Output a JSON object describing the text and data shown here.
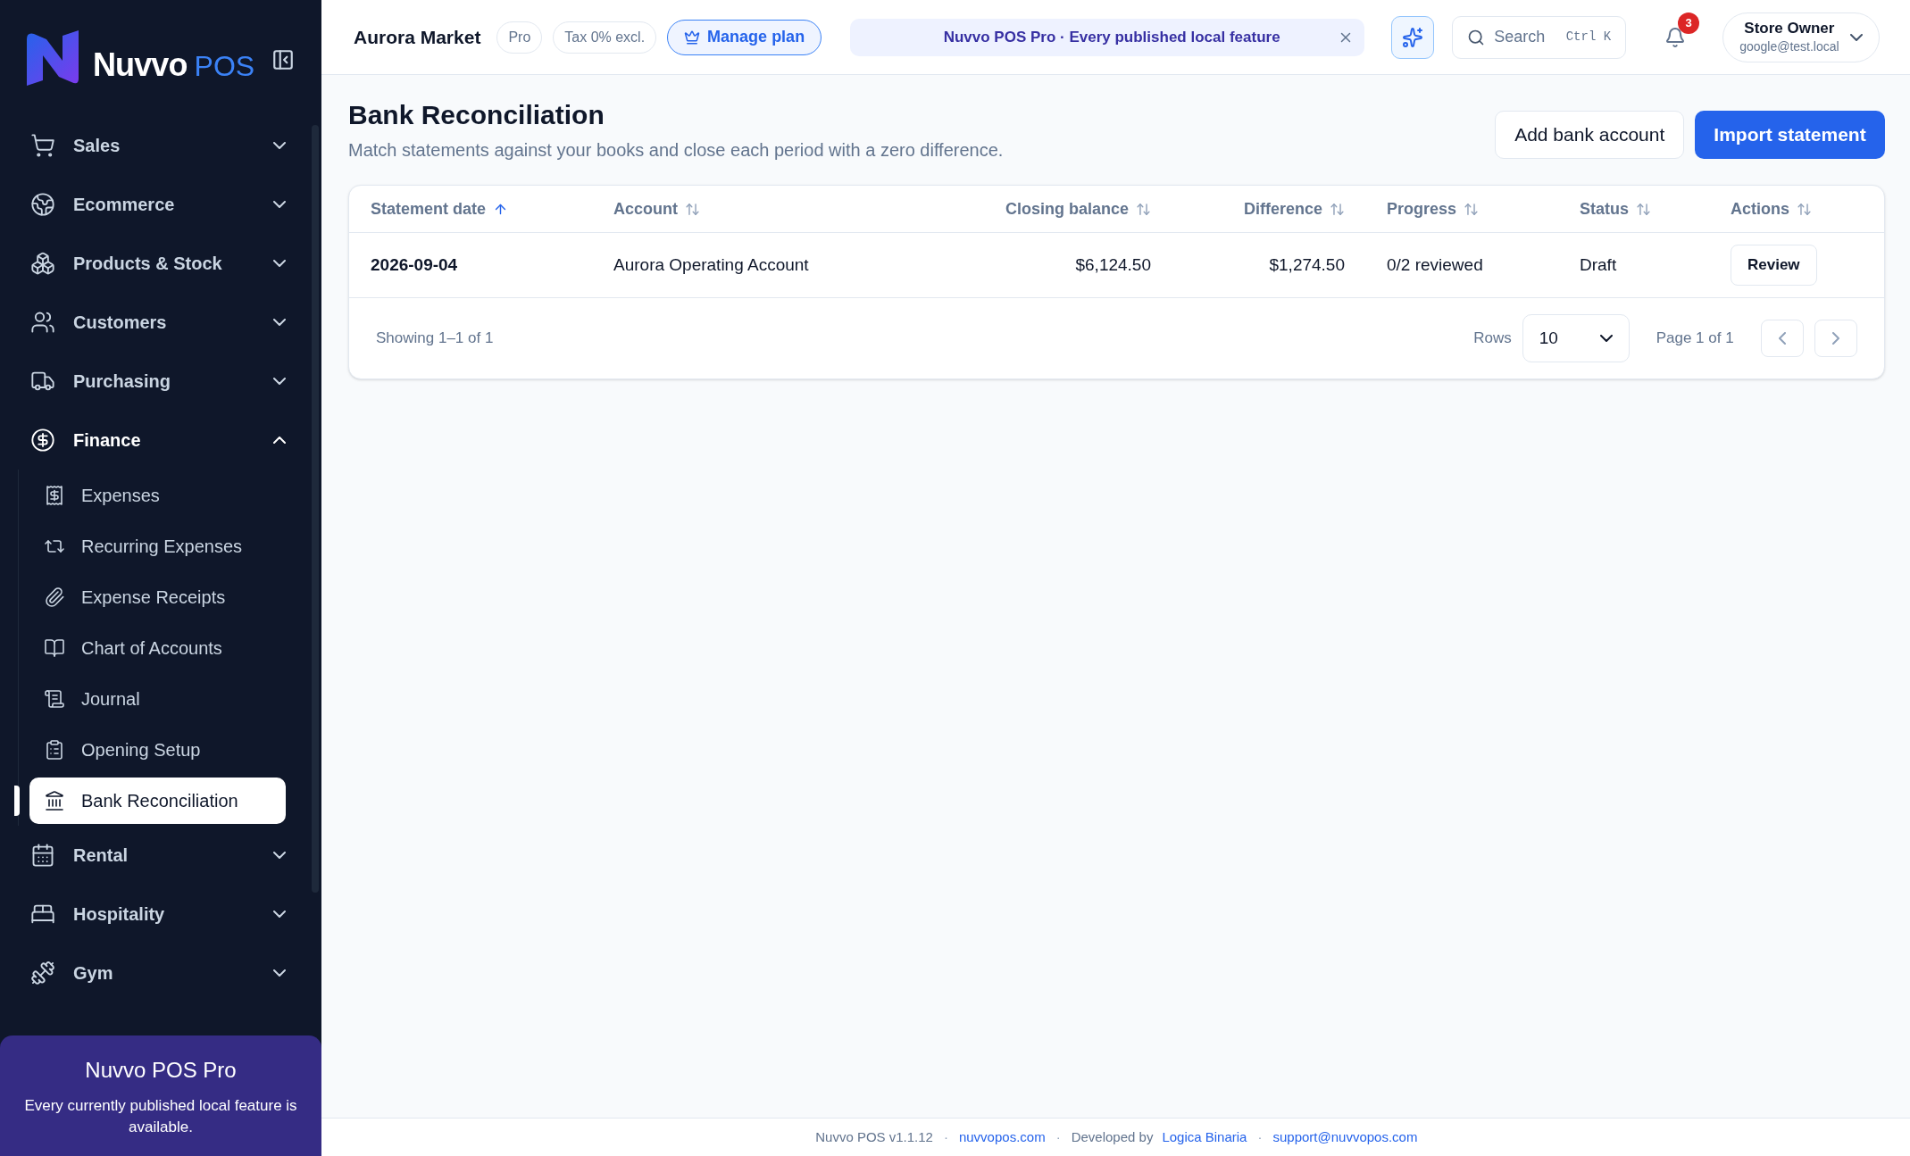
{
  "brand": {
    "name": "Nuvvo",
    "suffix": "POS"
  },
  "sidebar": {
    "items": [
      {
        "label": "Sales",
        "expanded": false
      },
      {
        "label": "Ecommerce",
        "expanded": false
      },
      {
        "label": "Products & Stock",
        "expanded": false
      },
      {
        "label": "Customers",
        "expanded": false
      },
      {
        "label": "Purchasing",
        "expanded": false
      },
      {
        "label": "Finance",
        "expanded": true,
        "children": [
          {
            "label": "Expenses",
            "selected": false
          },
          {
            "label": "Recurring Expenses",
            "selected": false
          },
          {
            "label": "Expense Receipts",
            "selected": false
          },
          {
            "label": "Chart of Accounts",
            "selected": false
          },
          {
            "label": "Journal",
            "selected": false
          },
          {
            "label": "Opening Setup",
            "selected": false
          },
          {
            "label": "Bank Reconciliation",
            "selected": true
          }
        ]
      },
      {
        "label": "Rental",
        "expanded": false
      },
      {
        "label": "Hospitality",
        "expanded": false
      },
      {
        "label": "Gym",
        "expanded": false
      }
    ]
  },
  "promo": {
    "title": "Nuvvo POS Pro",
    "text": "Every currently published local feature is available."
  },
  "topbar": {
    "store_name": "Aurora Market",
    "plan_badge": "Pro",
    "tax_badge": "Tax 0% excl.",
    "manage_plan": "Manage plan",
    "banner": "Nuvvo POS Pro · Every published local feature",
    "search": {
      "placeholder": "Search",
      "shortcut": "Ctrl K"
    },
    "notifications": "3",
    "user": {
      "name": "Store Owner",
      "email": "google@test.local"
    }
  },
  "page": {
    "title": "Bank Reconciliation",
    "subtitle": "Match statements against your books and close each period with a zero difference.",
    "buttons": [
      {
        "label": "Add bank account",
        "kind": "secondary"
      },
      {
        "label": "Import statement",
        "kind": "primary"
      }
    ]
  },
  "table": {
    "columns": [
      {
        "label": "Statement date",
        "sorted": true
      },
      {
        "label": "Account",
        "sorted": false
      },
      {
        "label": "Closing balance",
        "sorted": false
      },
      {
        "label": "Difference",
        "sorted": false
      },
      {
        "label": "Progress",
        "sorted": false
      },
      {
        "label": "Status",
        "sorted": false
      },
      {
        "label": "Actions",
        "sorted": false
      }
    ],
    "rows": [
      {
        "cells": [
          "2026-09-04",
          "Aurora Operating Account",
          "$6,124.50",
          "$1,274.50",
          "0/2 reviewed",
          "Draft"
        ],
        "action": "Review"
      }
    ]
  },
  "pagination": {
    "showing": "Showing 1–1 of 1",
    "rows_label": "Rows",
    "rows_value": "10",
    "page": "Page 1 of 1"
  },
  "footer": [
    {
      "text": "Nuvvo POS v1.1.12",
      "kind": "text"
    },
    {
      "text": "·",
      "kind": "separator"
    },
    {
      "text": "nuvvopos.com",
      "kind": "link"
    },
    {
      "text": "·",
      "kind": "separator"
    },
    {
      "text": "Developed by",
      "kind": "text"
    },
    {
      "text": "Logica Binaria",
      "kind": "link"
    },
    {
      "text": "·",
      "kind": "separator"
    },
    {
      "text": "support@nuvvopos.com",
      "kind": "link"
    }
  ]
}
